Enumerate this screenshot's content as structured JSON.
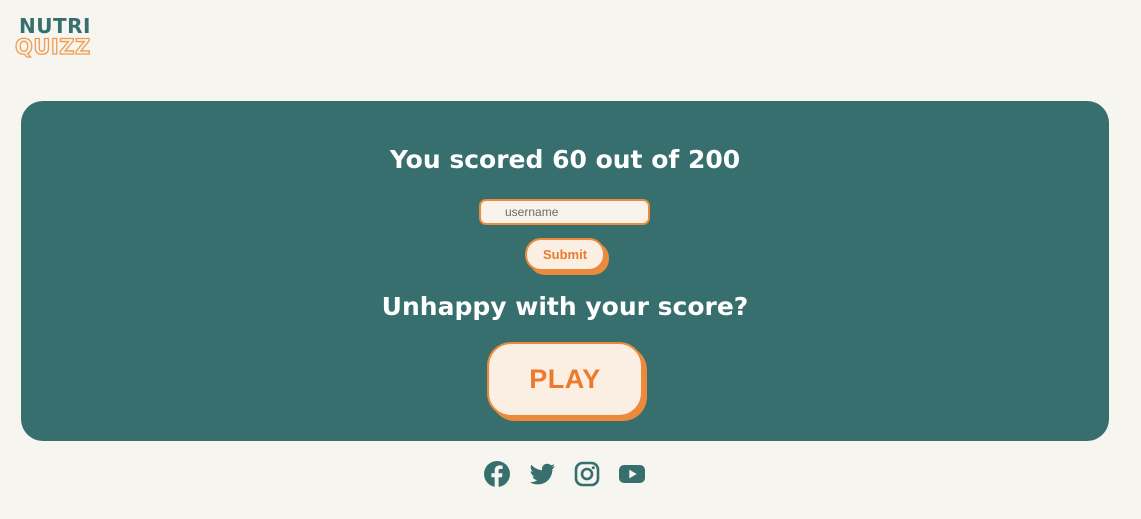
{
  "logo": {
    "line1": "NUTRI",
    "line2": "QUIZZ"
  },
  "result": {
    "score_text": "You scored 60 out of 200"
  },
  "form": {
    "username_placeholder": "username",
    "submit_label": "Submit"
  },
  "retry": {
    "heading": "Unhappy with your score?",
    "play_label": "PLAY"
  },
  "socials": [
    {
      "icon": "facebook-icon"
    },
    {
      "icon": "twitter-icon"
    },
    {
      "icon": "instagram-icon"
    },
    {
      "icon": "youtube-icon"
    }
  ],
  "colors": {
    "background": "#f7f5ef",
    "card": "#366f6d",
    "accent_orange": "#ec8a3c",
    "button_fill": "#fbeee3",
    "text_light": "#ffffff"
  }
}
